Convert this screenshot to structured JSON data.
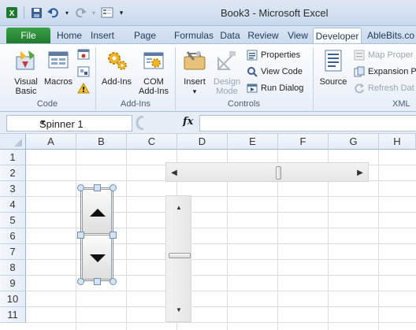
{
  "window": {
    "title": "Book3 - Microsoft Excel"
  },
  "qat": {
    "icons": [
      "excel-logo-icon",
      "save-icon",
      "undo-icon",
      "redo-icon",
      "form-icon"
    ]
  },
  "tabs": [
    "File",
    "Home",
    "Insert",
    "Page Layou",
    "Formulas",
    "Data",
    "Review",
    "View",
    "Developer",
    "AbleBits.co"
  ],
  "active_tab": "Developer",
  "ribbon": {
    "code": {
      "label": "Code",
      "visual_basic": "Visual Basic",
      "macros": "Macros"
    },
    "addins": {
      "label": "Add-Ins",
      "add_ins": "Add-Ins",
      "com_add_ins": "COM Add-Ins"
    },
    "controls": {
      "label": "Controls",
      "insert": "Insert",
      "design_mode": "Design Mode",
      "properties": "Properties",
      "view_code": "View Code",
      "run_dialog": "Run Dialog"
    },
    "xml": {
      "label": "XML",
      "source": "Source",
      "map_properties": "Map Proper",
      "expansion_packs": "Expansion P",
      "refresh_data": "Refresh Dat"
    }
  },
  "formula_bar": {
    "name_box": "Spinner 1",
    "fx": "fx",
    "value": ""
  },
  "grid": {
    "columns": [
      "A",
      "B",
      "C",
      "D",
      "E",
      "F",
      "G",
      "H"
    ],
    "rows": [
      "1",
      "2",
      "3",
      "4",
      "5",
      "6",
      "7",
      "8",
      "9",
      "10",
      "11"
    ]
  },
  "controls": {
    "scrollbar_h_position": 0.55,
    "scrollbar_v_position": 0.45
  },
  "colors": {
    "file_tab": "#2a8c3a",
    "ribbon_bg": "#e7eef7",
    "selection_handle": "#6f8eb2"
  }
}
